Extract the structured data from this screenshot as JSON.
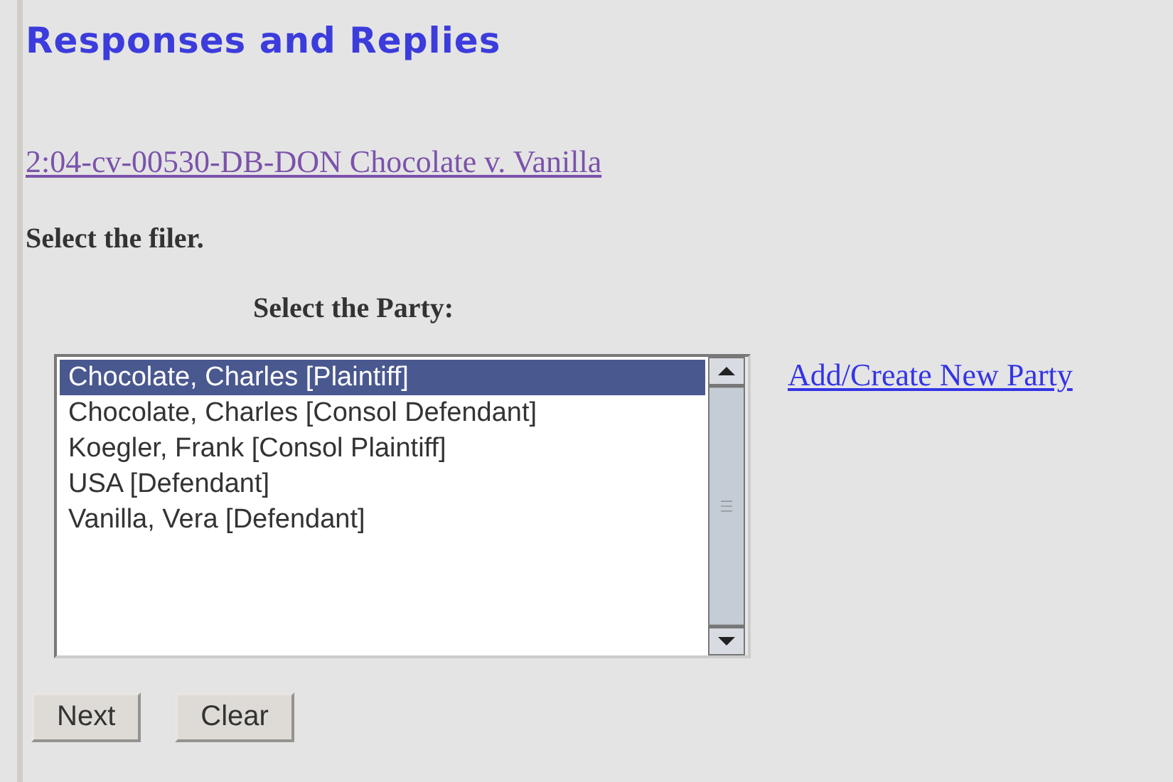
{
  "title": "Responses and Replies",
  "case_link": "2:04-cv-00530-DB-DON Chocolate v. Vanilla",
  "instruction": "Select the filer.",
  "party_label": "Select the Party:",
  "parties": [
    {
      "label": "Chocolate, Charles [Plaintiff]",
      "selected": true
    },
    {
      "label": "Chocolate, Charles [Consol Defendant]",
      "selected": false
    },
    {
      "label": "Koegler, Frank [Consol Plaintiff]",
      "selected": false
    },
    {
      "label": "USA [Defendant]",
      "selected": false
    },
    {
      "label": "Vanilla, Vera [Defendant]",
      "selected": false
    }
  ],
  "add_party_link": "Add/Create New Party",
  "buttons": [
    "Next",
    "Clear"
  ]
}
